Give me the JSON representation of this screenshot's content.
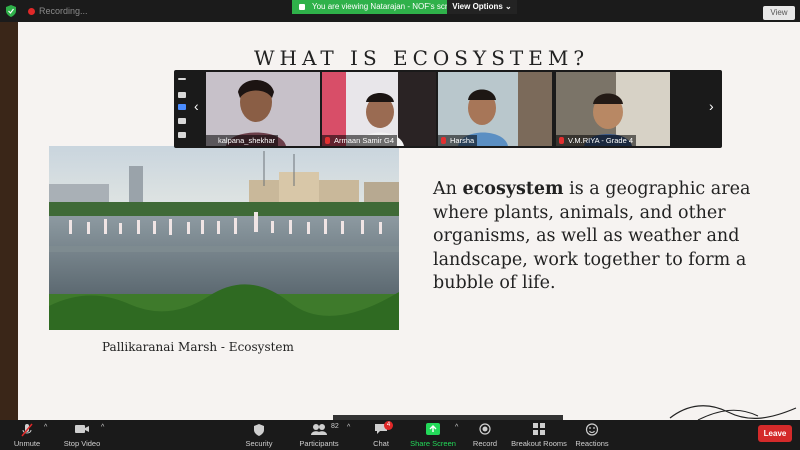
{
  "topbar": {
    "recording_label": "Recording...",
    "viewing_banner": "You are viewing Natarajan - NOF's screen",
    "view_options_label": "View Options ⌄",
    "view_button_label": "View"
  },
  "slide": {
    "title": "WHAT IS ECOSYSTEM?",
    "photo_caption": "Pallikaranai Marsh - Ecosystem",
    "body_prefix": "An ",
    "body_bold": "ecosystem",
    "body_rest": " is a geographic area where plants, animals, and other organisms, as well as weather and landscape, work together to form a bubble of life."
  },
  "participants": [
    {
      "name": "kalpana_shekhar"
    },
    {
      "name": "Armaan Samir G4"
    },
    {
      "name": "Harsha"
    },
    {
      "name": "V.M.RIYA - Grade 4"
    }
  ],
  "toolbar": {
    "unmute": "Unmute",
    "stop_video": "Stop Video",
    "security": "Security",
    "participants": "Participants",
    "participants_count": "82",
    "chat": "Chat",
    "chat_badge": "4",
    "share_screen": "Share Screen",
    "record": "Record",
    "breakout_rooms": "Breakout Rooms",
    "reactions": "Reactions",
    "leave": "Leave"
  },
  "colors": {
    "banner_green": "#2fb14a",
    "share_green": "#23d959",
    "leave_red": "#d42a2a",
    "slide_bg": "#f6f3f1"
  }
}
